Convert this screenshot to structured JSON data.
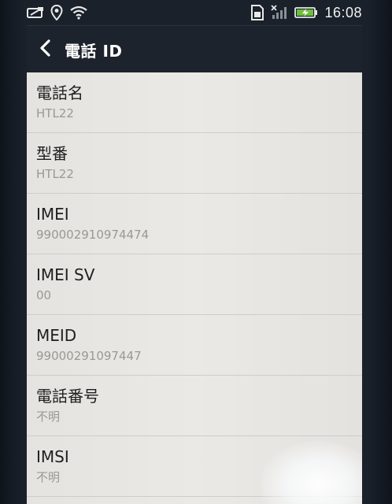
{
  "status_bar": {
    "time": "16:08",
    "icons": [
      "notification-card-icon",
      "location-icon",
      "wifi-icon",
      "sim-card-icon",
      "signal-no-service-icon",
      "battery-charging-icon"
    ]
  },
  "action_bar": {
    "title": "電話 ID",
    "back_icon": "chevron-left-icon"
  },
  "items": [
    {
      "title": "電話名",
      "value": "HTL22"
    },
    {
      "title": "型番",
      "value": "HTL22"
    },
    {
      "title": "IMEI",
      "value": "990002910974474"
    },
    {
      "title": "IMEI SV",
      "value": "00"
    },
    {
      "title": "MEID",
      "value": "99000291097447"
    },
    {
      "title": "電話番号",
      "value": "不明"
    },
    {
      "title": "IMSI",
      "value": "不明"
    }
  ],
  "colors": {
    "action_bar_bg": "#1d232c",
    "list_bg": "#ebe9e5",
    "title_text": "#1e1e1e",
    "value_text": "#9a9895",
    "battery_accent": "#6fbe3a"
  }
}
